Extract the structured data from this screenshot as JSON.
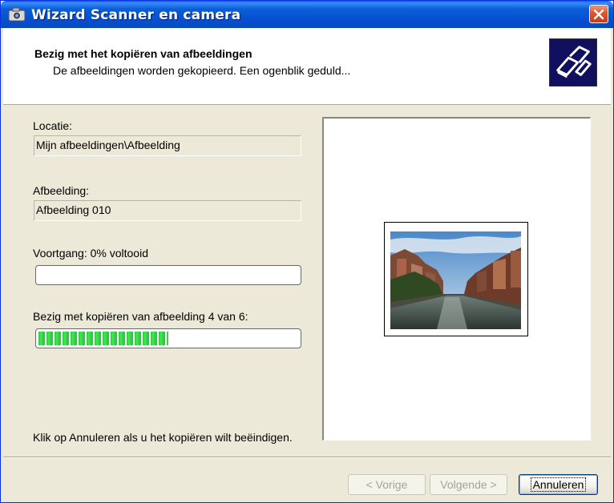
{
  "window": {
    "title": "Wizard Scanner en camera"
  },
  "header": {
    "title": "Bezig met het kopiëren van afbeeldingen",
    "subtitle": "De afbeeldingen worden gekopieerd. Een ogenblik geduld..."
  },
  "location": {
    "label": "Locatie:",
    "value": "Mijn afbeeldingen\\Afbeelding"
  },
  "image": {
    "label": "Afbeelding:",
    "value": "Afbeelding 010"
  },
  "progress": {
    "label": "Voortgang: 0% voltooid",
    "fraction": 0.0
  },
  "copy_progress": {
    "label": "Bezig met kopiëren van afbeelding 4 van 6:",
    "fraction": 0.5
  },
  "hint": "Klik op Annuleren als u het kopiëren wilt beëindigen.",
  "buttons": {
    "back": "< Vorige",
    "next": "Volgende >",
    "cancel": "Annuleren"
  },
  "colors": {
    "titlebar": "#0a5ed8",
    "progress_fill": "#2fc840",
    "header_icon_bg": "#10105e"
  }
}
